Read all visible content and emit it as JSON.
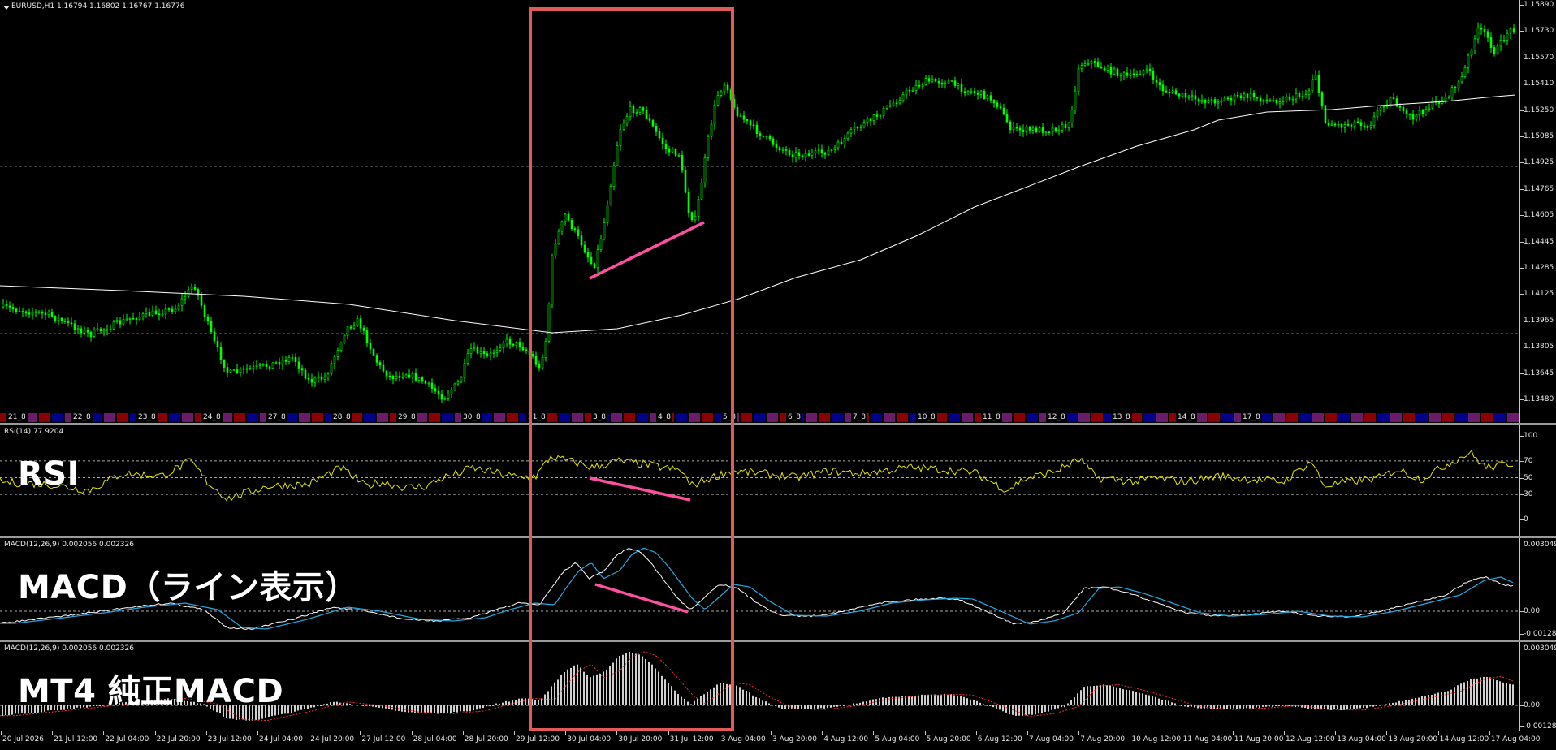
{
  "main": {
    "symbol_label": "EURUSD,H1  1.16794 1.16802 1.16767 1.16776",
    "price_ticks": [
      "1.15890",
      "1.15730",
      "1.15570",
      "1.15410",
      "1.15250",
      "1.15085",
      "1.14925",
      "1.14765",
      "1.14605",
      "1.14445",
      "1.14285",
      "1.14125",
      "1.13965",
      "1.13805",
      "1.13645",
      "1.13480"
    ],
    "day_labels": [
      "21_8",
      "22_8",
      "23_8",
      "24_8",
      "27_8",
      "28_8",
      "29_8",
      "30_8",
      "31_8",
      "3_8",
      "4_8",
      "5_8",
      "6_8",
      "7_8",
      "10_8",
      "11_8",
      "12_8",
      "13_8",
      "14_8",
      "17_8"
    ],
    "colors": {
      "candle": "#00ff00",
      "ma": "#ffffff",
      "annotation_pink": "#ff4fa0",
      "highlight_box": "#e05a5a"
    }
  },
  "rsi": {
    "label": "RSI(14) 77.9204",
    "title": "RSI",
    "level_ticks": [
      "100",
      "70",
      "50",
      "30",
      "0"
    ],
    "color": "#e6e600"
  },
  "macd_line": {
    "label": "MACD(12,26,9) 0.002056 0.002326",
    "title": "MACD（ライン表示）",
    "ticks": [
      "0.003049",
      "0.00",
      "-0.001286"
    ],
    "colors": {
      "macd": "#ffffff",
      "signal": "#29a8e0"
    }
  },
  "macd_mt4": {
    "label": "MACD(12,26,9) 0.002056 0.002326",
    "title": "MT4 純正MACD",
    "ticks": [
      "0.003049",
      "0.00",
      "-0.001286"
    ],
    "colors": {
      "histogram": "#d0d0d0",
      "signal": "#ff3030"
    }
  },
  "time_axis": [
    "20 Jul 2026",
    "21 Jul 12:00",
    "22 Jul 04:00",
    "22 Jul 20:00",
    "23 Jul 12:00",
    "24 Jul 04:00",
    "24 Jul 20:00",
    "27 Jul 12:00",
    "28 Jul 04:00",
    "28 Jul 20:00",
    "29 Jul 12:00",
    "30 Jul 04:00",
    "30 Jul 20:00",
    "31 Jul 12:00",
    "3 Aug 04:00",
    "3 Aug 20:00",
    "4 Aug 12:00",
    "5 Aug 04:00",
    "5 Aug 20:00",
    "6 Aug 12:00",
    "7 Aug 04:00",
    "7 Aug 20:00",
    "10 Aug 12:00",
    "11 Aug 04:00",
    "11 Aug 20:00",
    "12 Aug 12:00",
    "13 Aug 04:00",
    "13 Aug 20:00",
    "14 Aug 12:00",
    "17 Aug 04:00"
  ]
}
